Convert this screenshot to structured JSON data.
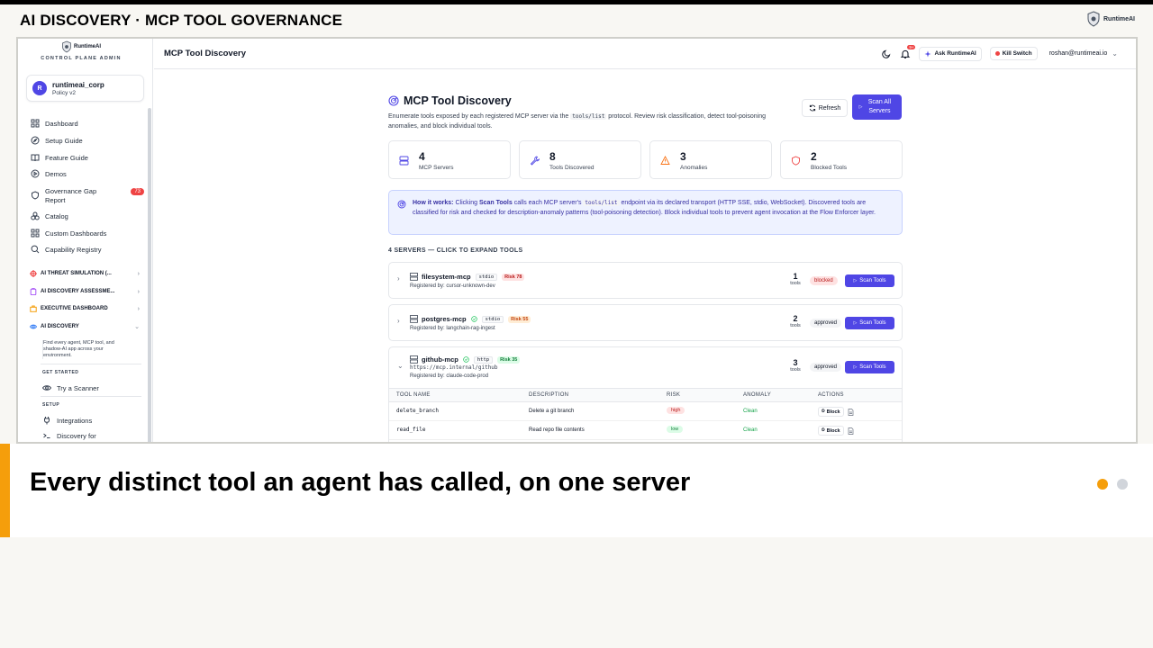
{
  "slide": {
    "title": "AI DISCOVERY · MCP TOOL GOVERNANCE",
    "brand": "RuntimeAI",
    "caption": "Every distinct tool an agent has called, on one server",
    "dots": [
      {
        "active": true,
        "color": "#f59e0b"
      },
      {
        "active": false,
        "color": "#d1d5db"
      }
    ]
  },
  "sidebar": {
    "brand": "RuntimeAI",
    "subtitle": "CONTROL PLANE ADMIN",
    "org": {
      "initial": "R",
      "name": "runtimeai_corp",
      "policy": "Policy v2"
    },
    "nav": [
      {
        "label": "Dashboard",
        "icon": "grid-icon"
      },
      {
        "label": "Setup Guide",
        "icon": "compass-icon"
      },
      {
        "label": "Feature Guide",
        "icon": "book-icon"
      },
      {
        "label": "Demos",
        "icon": "play-icon"
      },
      {
        "label": "Governance Gap Report",
        "icon": "shield-icon",
        "badge": "73"
      },
      {
        "label": "Catalog",
        "icon": "boxes-icon"
      },
      {
        "label": "Custom Dashboards",
        "icon": "grid-icon"
      },
      {
        "label": "Capability Registry",
        "icon": "search-icon"
      }
    ],
    "sections": [
      {
        "label": "AI THREAT SIMULATION (...",
        "color": "#ef4444"
      },
      {
        "label": "AI DISCOVERY ASSESSME...",
        "color": "#a855f7"
      },
      {
        "label": "EXECUTIVE DASHBOARD",
        "color": "#f59e0b"
      },
      {
        "label": "AI DISCOVERY",
        "color": "#3b82f6"
      }
    ],
    "discovery_desc": "Find every agent, MCP tool, and shadow-AI app across your environment.",
    "get_started_label": "GET STARTED",
    "try_scanner": "Try a Scanner",
    "setup_label": "SETUP",
    "integrations": "Integrations",
    "discovery_for": "Discovery for"
  },
  "header": {
    "title": "MCP Tool Discovery",
    "notif_count": "9+",
    "ask_label": "Ask RuntimeAI",
    "kill_label": "Kill Switch",
    "user": "roshan@runtimeai.io"
  },
  "page": {
    "title": "MCP Tool Discovery",
    "desc_pre": "Enumerate tools exposed by each registered MCP server via the",
    "desc_code": "tools/list",
    "desc_post": "protocol. Review risk classification, detect tool-poisoning anomalies, and block individual tools.",
    "refresh_label": "Refresh",
    "scan_all_label": "Scan All Servers"
  },
  "stats": [
    {
      "value": "4",
      "label": "MCP Servers",
      "icon": "server-icon",
      "color": "#4f46e5"
    },
    {
      "value": "8",
      "label": "Tools Discovered",
      "icon": "wrench-icon",
      "color": "#4f46e5"
    },
    {
      "value": "3",
      "label": "Anomalies",
      "icon": "warning-icon",
      "color": "#f97316"
    },
    {
      "value": "2",
      "label": "Blocked Tools",
      "icon": "shield-icon",
      "color": "#ef4444"
    }
  ],
  "how": {
    "lead": "How it works:",
    "p1": "Clicking",
    "scan_bold": "Scan Tools",
    "p2": "calls each MCP server's",
    "code": "tools/list",
    "p3": "endpoint via its declared transport (HTTP SSE, stdio, WebSocket). Discovered tools are classified for risk and checked for description-anomaly patterns (tool-poisoning detection). Block individual tools to prevent agent invocation at the Flow Enforcer layer."
  },
  "servers_heading": "4 SERVERS — CLICK TO EXPAND TOOLS",
  "servers": [
    {
      "name": "filesystem-mcp",
      "transport": "stdio",
      "risk": "Risk 78",
      "registered": "Registered by: cursor-unknown-dev",
      "tools": "1",
      "tools_label": "tools",
      "status": "blocked",
      "scan_label": "Scan Tools"
    },
    {
      "name": "postgres-mcp",
      "transport": "stdio",
      "risk": "Risk 55",
      "registered": "Registered by: langchain-rag-ingest",
      "tools": "2",
      "tools_label": "tools",
      "status": "approved",
      "scan_label": "Scan Tools"
    },
    {
      "name": "github-mcp",
      "transport": "http",
      "risk": "Risk 35",
      "url": "https://mcp.internal/github",
      "registered": "Registered by: claude-code-prod",
      "tools": "3",
      "tools_label": "tools",
      "status": "approved",
      "scan_label": "Scan Tools"
    }
  ],
  "tool_table": {
    "headers": [
      "TOOL NAME",
      "DESCRIPTION",
      "RISK",
      "ANOMALY",
      "ACTIONS"
    ],
    "rows": [
      {
        "name": "delete_branch",
        "desc": "Delete a git branch",
        "risk": "high",
        "anomaly": "Clean",
        "action": "Block"
      },
      {
        "name": "read_file",
        "desc": "Read repo file contents",
        "risk": "low",
        "anomaly": "Clean",
        "action": "Block"
      }
    ]
  }
}
